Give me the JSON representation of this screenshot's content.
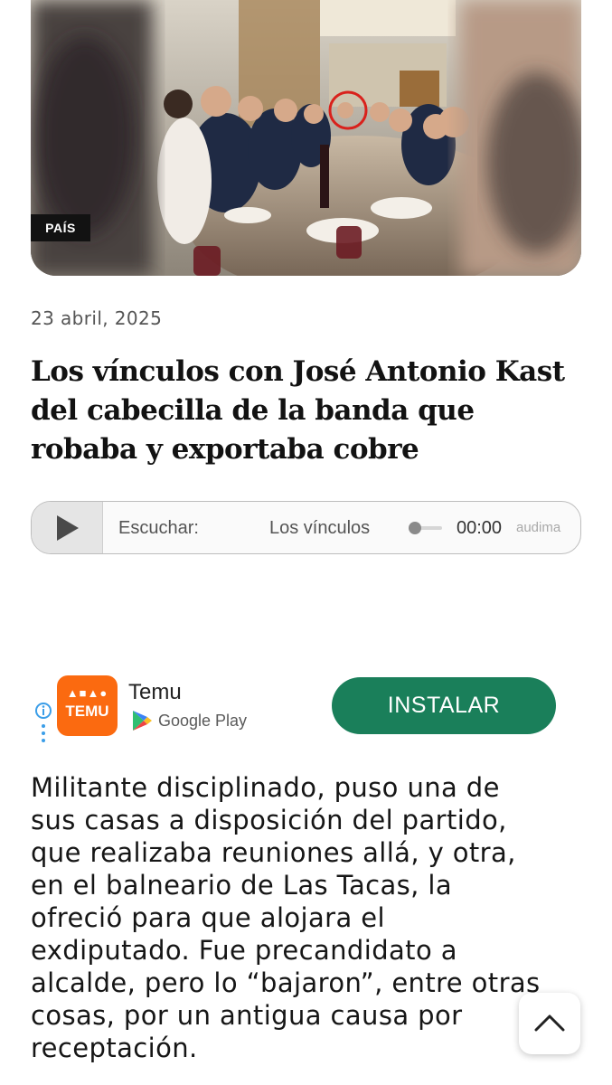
{
  "article": {
    "category": "PAÍS",
    "date": "23 abril, 2025",
    "title": "Los vínculos con José Antonio Kast del cabecilla de la banda que robaba y exportaba cobre",
    "body": "Militante disciplinado, puso una de\nsus casas a disposición del partido,\nque realizaba reuniones allá, y otra,\nen el balneario de Las Tacas, la\nofreció para que alojara el\nexdiputado. Fue precandidato a\nalcalde, pero lo “bajaron”, entre otras\ncosas, por un antigua causa por\nreceptación."
  },
  "player": {
    "listen_label": "Escuchar:",
    "track_name": "Los vínculos",
    "time": "00:00",
    "brand": "audima",
    "play_icon": "play-icon",
    "progress": 0
  },
  "ad": {
    "app_name": "Temu",
    "logo_word": "TEMU",
    "store_name": "Google Play",
    "install_label": "INSTALAR",
    "install_color": "#1a7f5a",
    "logo_color": "#fb6a10",
    "info_icon": "info-icon"
  },
  "scroll_top": {
    "icon": "chevron-up-icon"
  }
}
